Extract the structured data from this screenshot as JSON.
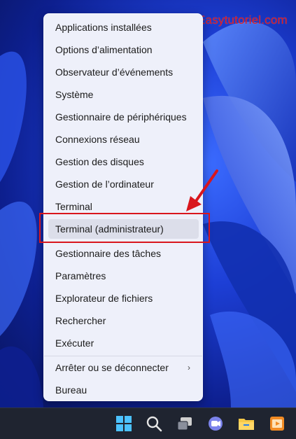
{
  "watermark": "Easytutoriel.com",
  "menu": {
    "items": [
      {
        "label": "Applications installées"
      },
      {
        "label": "Options d’alimentation"
      },
      {
        "label": "Observateur d’événements"
      },
      {
        "label": "Système"
      },
      {
        "label": "Gestionnaire de périphériques"
      },
      {
        "label": "Connexions réseau"
      },
      {
        "label": "Gestion des disques"
      },
      {
        "label": "Gestion de l’ordinateur"
      },
      {
        "label": "Terminal"
      },
      {
        "label": "Terminal (administrateur)"
      },
      {
        "label": "Gestionnaire des tâches"
      },
      {
        "label": "Paramètres"
      },
      {
        "label": "Explorateur de fichiers"
      },
      {
        "label": "Rechercher"
      },
      {
        "label": "Exécuter"
      },
      {
        "label": "Arrêter ou se déconnecter"
      },
      {
        "label": "Bureau"
      }
    ],
    "submenu_chevron": "›"
  },
  "colors": {
    "menu_bg": "#eef0fa",
    "hover_bg": "#dcdeea",
    "highlight": "#d9161d",
    "taskbar": "#1f2430"
  },
  "taskbar": {
    "icons": [
      "windows-start-icon",
      "search-icon",
      "task-view-icon",
      "teams-chat-icon",
      "file-explorer-icon",
      "media-player-icon"
    ]
  }
}
